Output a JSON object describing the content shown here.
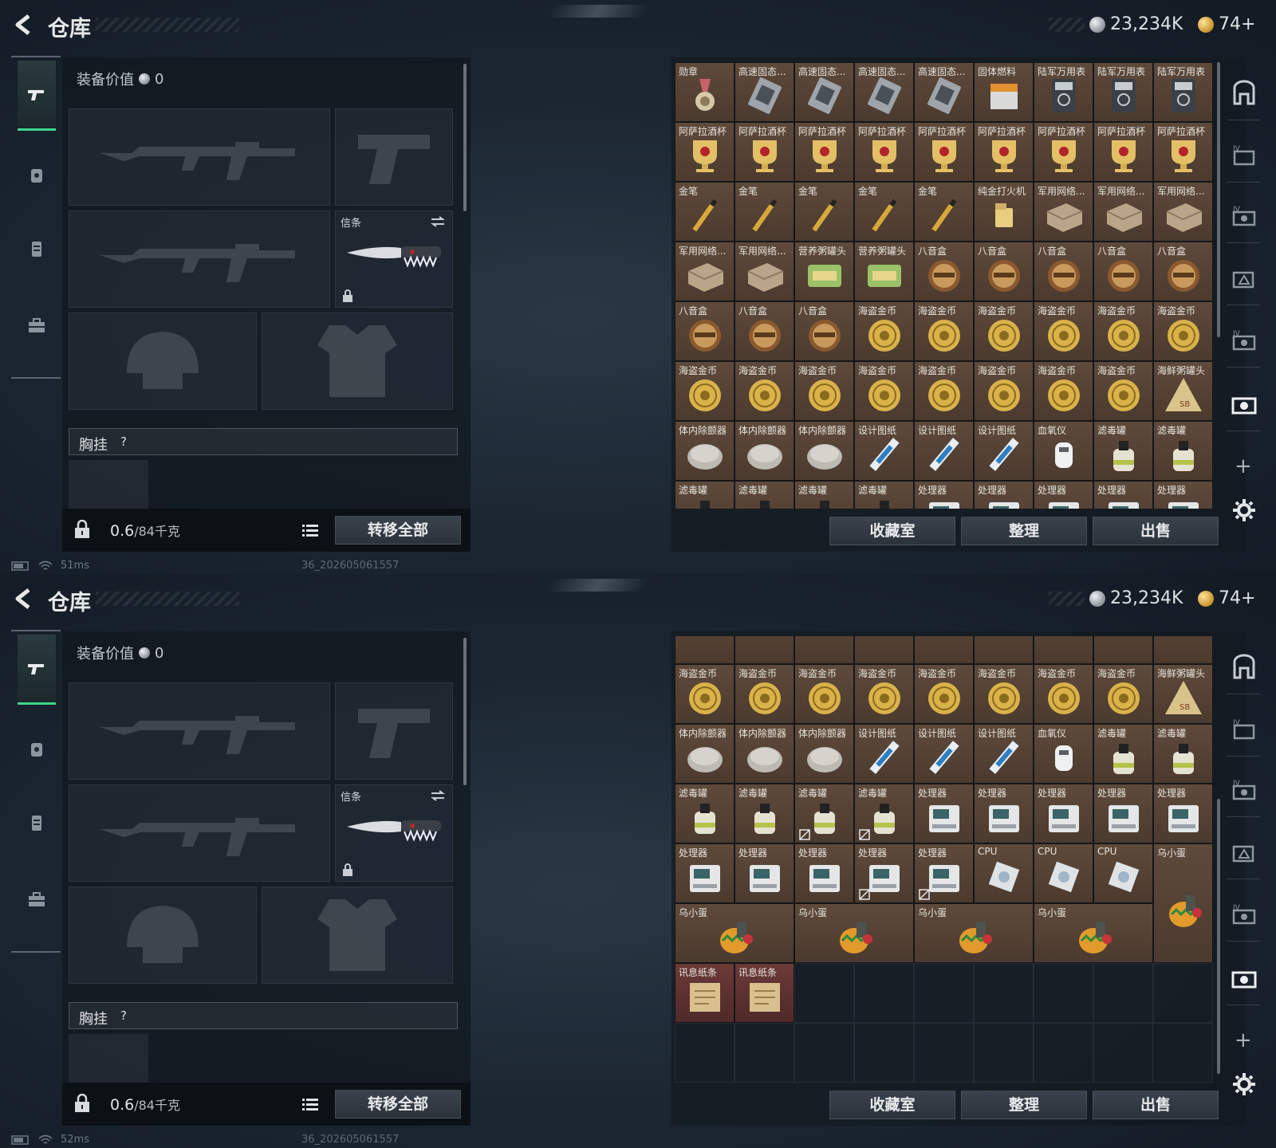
{
  "header": {
    "title": "仓库",
    "silver_amount": "23,234K",
    "gold_amount": "74+"
  },
  "equipment": {
    "value_label": "装备价值",
    "value": "0",
    "melee_slot_label": "信条",
    "chest_label": "胸挂",
    "chest_help": "?",
    "weight_current": "0.6",
    "weight_max": "/84千克",
    "transfer_all": "转移全部"
  },
  "storage": {
    "collection_label": "收藏室",
    "sort_label": "整理",
    "sell_label": "出售",
    "grid_top": [
      [
        "勋章",
        "高速固态...",
        "高速固态...",
        "高速固态...",
        "高速固态...",
        "固体燃料",
        "陆军万用表",
        "陆军万用表",
        "陆军万用表"
      ],
      [
        "阿萨拉酒杯",
        "阿萨拉酒杯",
        "阿萨拉酒杯",
        "阿萨拉酒杯",
        "阿萨拉酒杯",
        "阿萨拉酒杯",
        "阿萨拉酒杯",
        "阿萨拉酒杯",
        "阿萨拉酒杯"
      ],
      [
        "金笔",
        "金笔",
        "金笔",
        "金笔",
        "金笔",
        "纯金打火机",
        "军用网络...",
        "军用网络...",
        "军用网络..."
      ],
      [
        "军用网络...",
        "军用网络...",
        "营养粥罐头",
        "营养粥罐头",
        "八音盒",
        "八音盒",
        "八音盒",
        "八音盒",
        "八音盒"
      ],
      [
        "八音盒",
        "八音盒",
        "八音盒",
        "海盗金币",
        "海盗金币",
        "海盗金币",
        "海盗金币",
        "海盗金币",
        "海盗金币"
      ],
      [
        "海盗金币",
        "海盗金币",
        "海盗金币",
        "海盗金币",
        "海盗金币",
        "海盗金币",
        "海盗金币",
        "海盗金币",
        "海鲜粥罐头"
      ],
      [
        "体内除颤器",
        "体内除颤器",
        "体内除颤器",
        "设计图纸",
        "设计图纸",
        "设计图纸",
        "血氧仪",
        "滤毒罐",
        "滤毒罐"
      ],
      [
        "滤毒罐",
        "滤毒罐",
        "滤毒罐",
        "滤毒罐",
        "处理器",
        "处理器",
        "处理器",
        "处理器",
        "处理器"
      ]
    ],
    "grid_bottom": [
      [
        "海盗金币",
        "海盗金币",
        "海盗金币",
        "海盗金币",
        "海盗金币",
        "海盗金币",
        "海盗金币",
        "海盗金币",
        "海鲜粥罐头"
      ],
      [
        "体内除颤器",
        "体内除颤器",
        "体内除颤器",
        "设计图纸",
        "设计图纸",
        "设计图纸",
        "血氧仪",
        "滤毒罐",
        "滤毒罐"
      ],
      [
        "滤毒罐",
        "滤毒罐",
        "滤毒罐",
        "滤毒罐",
        "处理器",
        "处理器",
        "处理器",
        "处理器",
        "处理器"
      ],
      [
        "处理器",
        "处理器",
        "处理器",
        "处理器",
        "处理器",
        "CPU",
        "CPU",
        "CPU",
        "乌小蛋"
      ],
      [
        "乌小蛋",
        "乌小蛋",
        "乌小蛋",
        "乌小蛋"
      ],
      [
        "讯息纸条",
        "讯息纸条"
      ]
    ]
  },
  "status": {
    "ping_top": "51ms",
    "ping_bottom": "52ms",
    "build": "36_202605061557"
  }
}
